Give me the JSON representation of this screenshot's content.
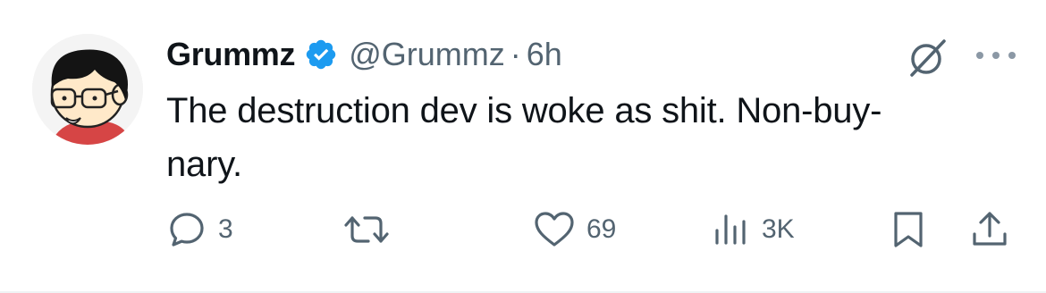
{
  "tweet": {
    "author_name": "Grummz",
    "handle": "@Grummz",
    "separator": "·",
    "time": "6h",
    "text_lines": [
      "The destruction dev is woke as shit. Non-buy-",
      "nary."
    ],
    "verified": true
  },
  "actions": {
    "reply_count": "3",
    "retweet_count": "",
    "like_count": "69",
    "views_count": "3K"
  },
  "icons": {
    "verified": "verified-badge-icon",
    "grok": "grok-icon",
    "more": "more-dots-icon",
    "reply": "reply-icon",
    "retweet": "retweet-icon",
    "like": "heart-icon",
    "views": "views-icon",
    "bookmark": "bookmark-icon",
    "share": "share-icon"
  },
  "colors": {
    "primary_text": "#0f1419",
    "secondary_text": "#536471",
    "verified_blue": "#1d9bf0",
    "avatar_shirt": "#d64545"
  }
}
